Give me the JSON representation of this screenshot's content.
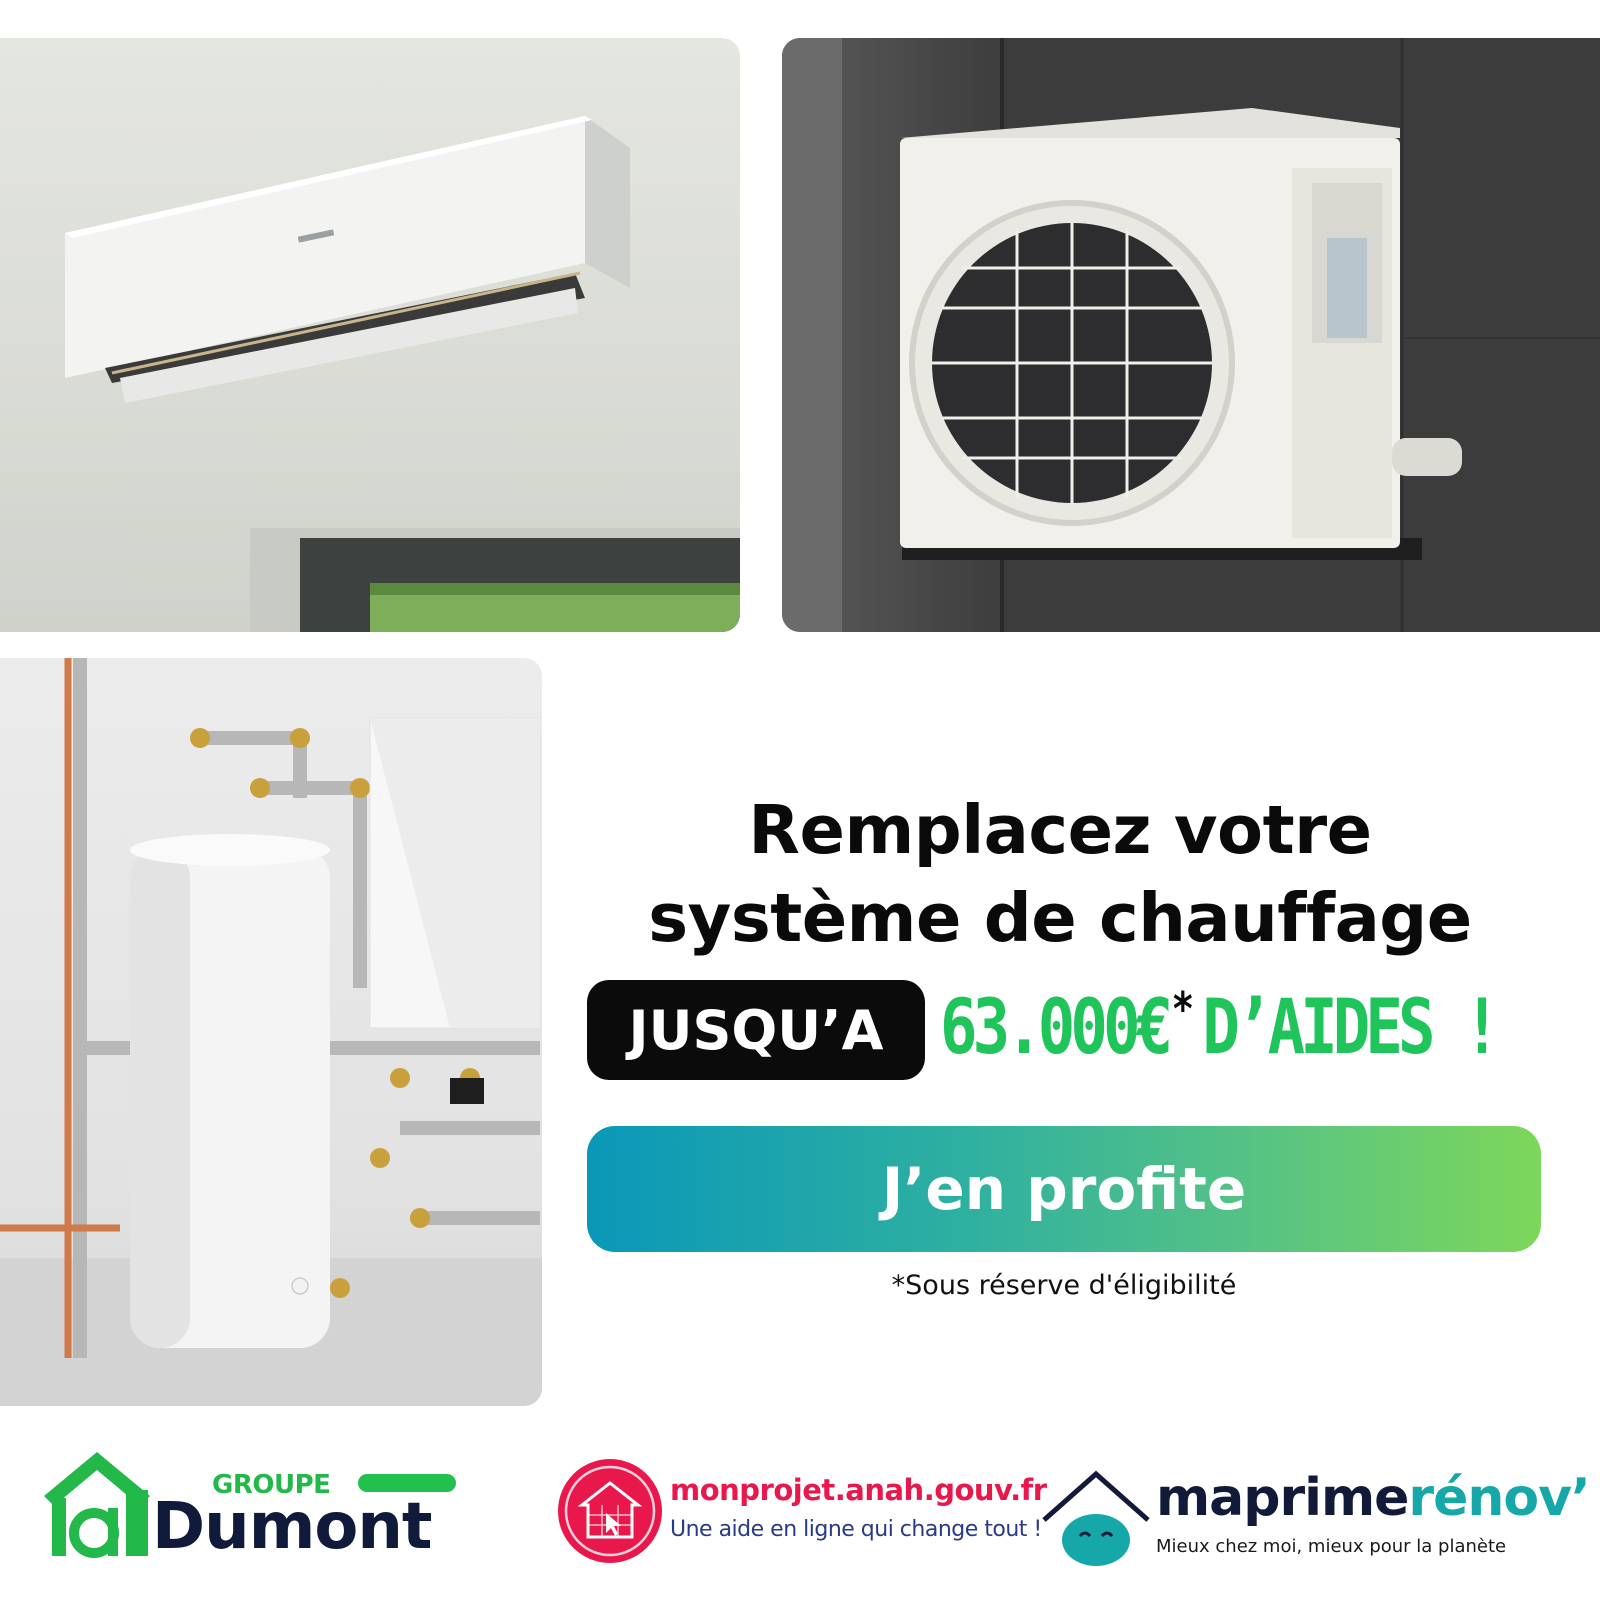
{
  "headline": {
    "line1": "Remplacez votre",
    "line2": "système de chauffage"
  },
  "offer": {
    "pill_label": "JUSQU’A",
    "amount": "63.000€",
    "asterisk": "*",
    "suffix": "D’AIDES !"
  },
  "cta": {
    "label": "J’en profite"
  },
  "note": "*Sous réserve d'éligibilité",
  "logos": {
    "dumont": {
      "groupe": "GROUPE",
      "name": "Dumont"
    },
    "anah": {
      "url": "monprojet.anah.gouv.fr",
      "tagline": "Une aide en ligne qui change tout !"
    },
    "maprimerenov": {
      "name_part1": "maprime",
      "name_part2": "rénov’",
      "tagline": "Mieux chez moi, mieux pour la planète"
    }
  },
  "colors": {
    "green_accent": "#1fc45a",
    "cta_gradient_start": "#0a98b8",
    "cta_gradient_end": "#7dd75a",
    "anah_red": "#e8184c",
    "dumont_navy": "#101a3a",
    "mpr_teal": "#16a7a9"
  }
}
